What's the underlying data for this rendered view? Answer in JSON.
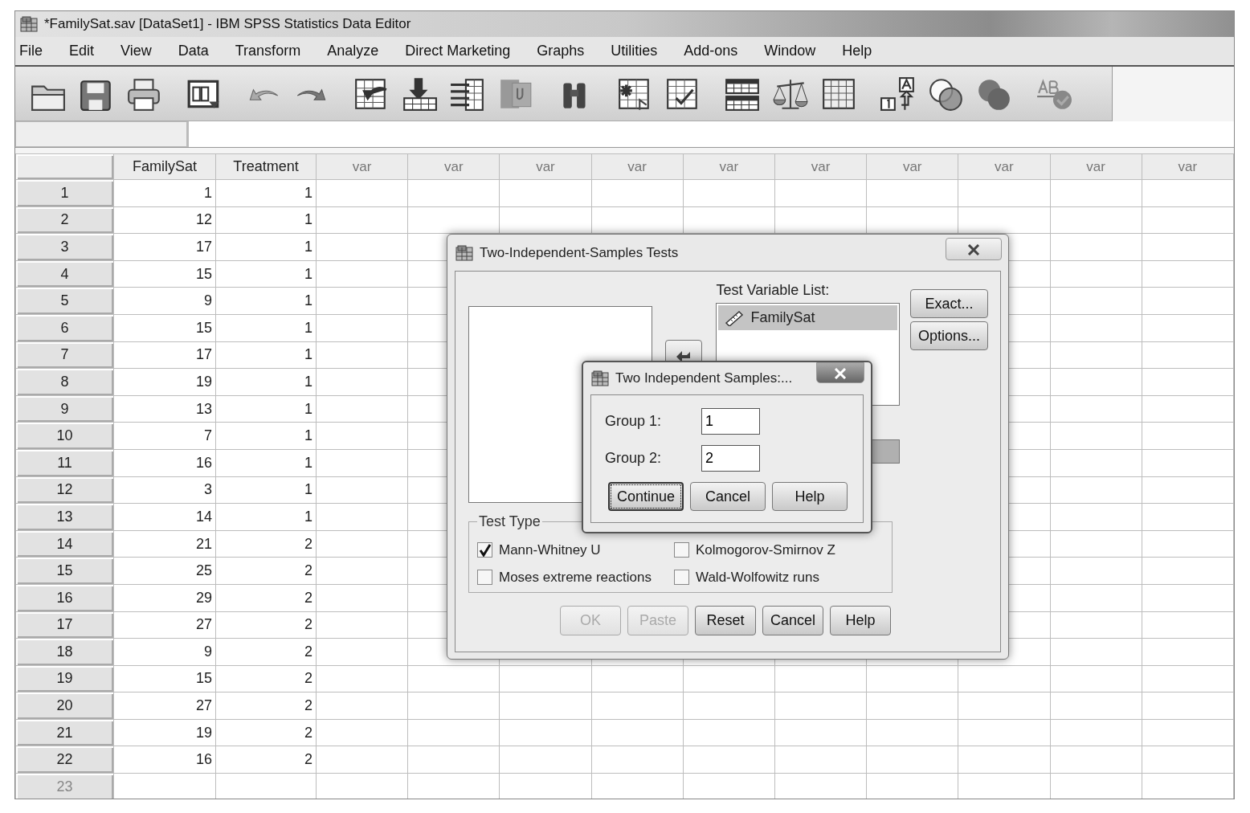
{
  "window": {
    "title": "*FamilySat.sav [DataSet1] - IBM SPSS Statistics Data Editor"
  },
  "menu": [
    "File",
    "Edit",
    "View",
    "Data",
    "Transform",
    "Analyze",
    "Direct Marketing",
    "Graphs",
    "Utilities",
    "Add-ons",
    "Window",
    "Help"
  ],
  "grid": {
    "columns": [
      "FamilySat",
      "Treatment",
      "var",
      "var",
      "var",
      "var",
      "var",
      "var",
      "var",
      "var",
      "var",
      "var"
    ],
    "rows": [
      {
        "kind": "data",
        "number": "1",
        "cells": [
          "1",
          "1"
        ]
      },
      {
        "kind": "data",
        "number": "2",
        "cells": [
          "12",
          "1"
        ]
      },
      {
        "kind": "data",
        "number": "3",
        "cells": [
          "17",
          "1"
        ]
      },
      {
        "kind": "data",
        "number": "4",
        "cells": [
          "15",
          "1"
        ]
      },
      {
        "kind": "data",
        "number": "5",
        "cells": [
          "9",
          "1"
        ]
      },
      {
        "kind": "data",
        "number": "6",
        "cells": [
          "15",
          "1"
        ]
      },
      {
        "kind": "data",
        "number": "7",
        "cells": [
          "17",
          "1"
        ]
      },
      {
        "kind": "data",
        "number": "8",
        "cells": [
          "19",
          "1"
        ]
      },
      {
        "kind": "data",
        "number": "9",
        "cells": [
          "13",
          "1"
        ]
      },
      {
        "kind": "data",
        "number": "10",
        "cells": [
          "7",
          "1"
        ]
      },
      {
        "kind": "data",
        "number": "11",
        "cells": [
          "16",
          "1"
        ]
      },
      {
        "kind": "data",
        "number": "12",
        "cells": [
          "3",
          "1"
        ]
      },
      {
        "kind": "data",
        "number": "13",
        "cells": [
          "14",
          "1"
        ]
      },
      {
        "kind": "data",
        "number": "14",
        "cells": [
          "21",
          "2"
        ]
      },
      {
        "kind": "data",
        "number": "15",
        "cells": [
          "25",
          "2"
        ]
      },
      {
        "kind": "data",
        "number": "16",
        "cells": [
          "29",
          "2"
        ]
      },
      {
        "kind": "data",
        "number": "17",
        "cells": [
          "27",
          "2"
        ]
      },
      {
        "kind": "data",
        "number": "18",
        "cells": [
          "9",
          "2"
        ]
      },
      {
        "kind": "data",
        "number": "19",
        "cells": [
          "15",
          "2"
        ]
      },
      {
        "kind": "data",
        "number": "20",
        "cells": [
          "27",
          "2"
        ]
      },
      {
        "kind": "data",
        "number": "21",
        "cells": [
          "19",
          "2"
        ]
      },
      {
        "kind": "data",
        "number": "22",
        "cells": [
          "16",
          "2"
        ]
      },
      {
        "kind": "new",
        "number": "23",
        "cells": []
      }
    ]
  },
  "dialog": {
    "title": "Two-Independent-Samples Tests",
    "test_variable_list": {
      "label": "Test Variable List:",
      "items": [
        {
          "name": "FamilySat",
          "selected": true
        }
      ]
    },
    "side_buttons": [
      "Exact...",
      "Options..."
    ],
    "test_type": {
      "label": "Test Type",
      "options": [
        {
          "label": "Mann-Whitney U",
          "checked": true
        },
        {
          "label": "Kolmogorov-Smirnov Z",
          "checked": false
        },
        {
          "label": "Moses extreme reactions",
          "checked": false
        },
        {
          "label": "Wald-Wolfowitz runs",
          "checked": false
        }
      ]
    },
    "buttons": [
      {
        "label": "OK",
        "disabled": true
      },
      {
        "label": "Paste",
        "disabled": true
      },
      {
        "label": "Reset",
        "disabled": false
      },
      {
        "label": "Cancel",
        "disabled": false
      },
      {
        "label": "Help",
        "disabled": false
      }
    ]
  },
  "subdialog": {
    "title": "Two Independent Samples:...",
    "fields": [
      {
        "label": "Group 1:",
        "value": "1"
      },
      {
        "label": "Group 2:",
        "value": "2"
      }
    ],
    "buttons": [
      {
        "label": "Continue",
        "focused": true
      },
      {
        "label": "Cancel",
        "focused": false
      },
      {
        "label": "Help",
        "focused": false
      }
    ]
  }
}
